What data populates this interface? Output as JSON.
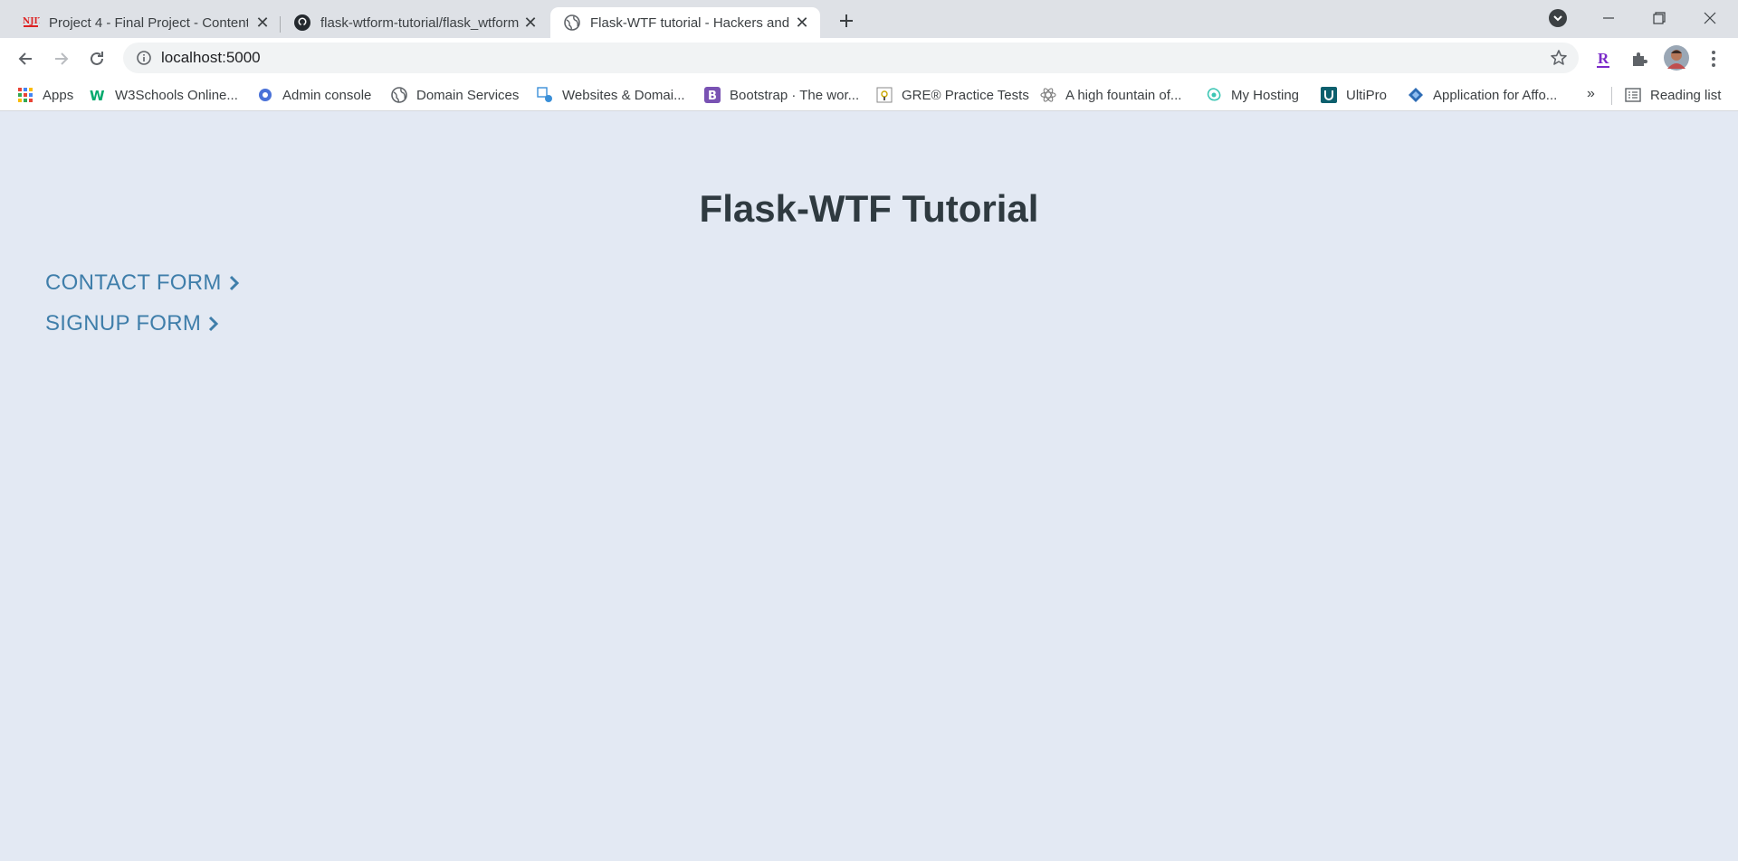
{
  "browser": {
    "tabs": [
      {
        "title": "Project 4 - Final Project - Content",
        "icon": "njit-icon",
        "active": false
      },
      {
        "title": "flask-wtform-tutorial/flask_wtforms",
        "icon": "github-icon",
        "active": false
      },
      {
        "title": "Flask-WTF tutorial - Hackers and Slackers",
        "icon": "globe-icon",
        "active": true
      }
    ],
    "address": "localhost:5000",
    "bookmarks": [
      {
        "label": "Apps",
        "icon": "apps-grid-icon"
      },
      {
        "label": "W3Schools Online...",
        "icon": "w3schools-icon"
      },
      {
        "label": "Admin console",
        "icon": "admin-gear-icon"
      },
      {
        "label": "Domain Services",
        "icon": "globe-icon"
      },
      {
        "label": "Websites & Domai...",
        "icon": "websites-icon"
      },
      {
        "label": "Bootstrap · The wor...",
        "icon": "bootstrap-icon"
      },
      {
        "label": "GRE® Practice Tests",
        "icon": "gre-icon"
      },
      {
        "label": "A high fountain of...",
        "icon": "atom-icon"
      },
      {
        "label": "My Hosting",
        "icon": "hosting-icon"
      },
      {
        "label": "UltiPro",
        "icon": "ultipro-icon"
      },
      {
        "label": "Application for Affo...",
        "icon": "diamond-icon"
      }
    ],
    "bookmarks_overflow": "»",
    "reading_list": "Reading list"
  },
  "page": {
    "title": "Flask-WTF Tutorial",
    "links": [
      {
        "label": "CONTACT FORM"
      },
      {
        "label": "SIGNUP FORM"
      }
    ]
  },
  "colors": {
    "page_background": "#e3e9f3",
    "link": "#3f7eaa",
    "heading": "#2f3a40"
  }
}
